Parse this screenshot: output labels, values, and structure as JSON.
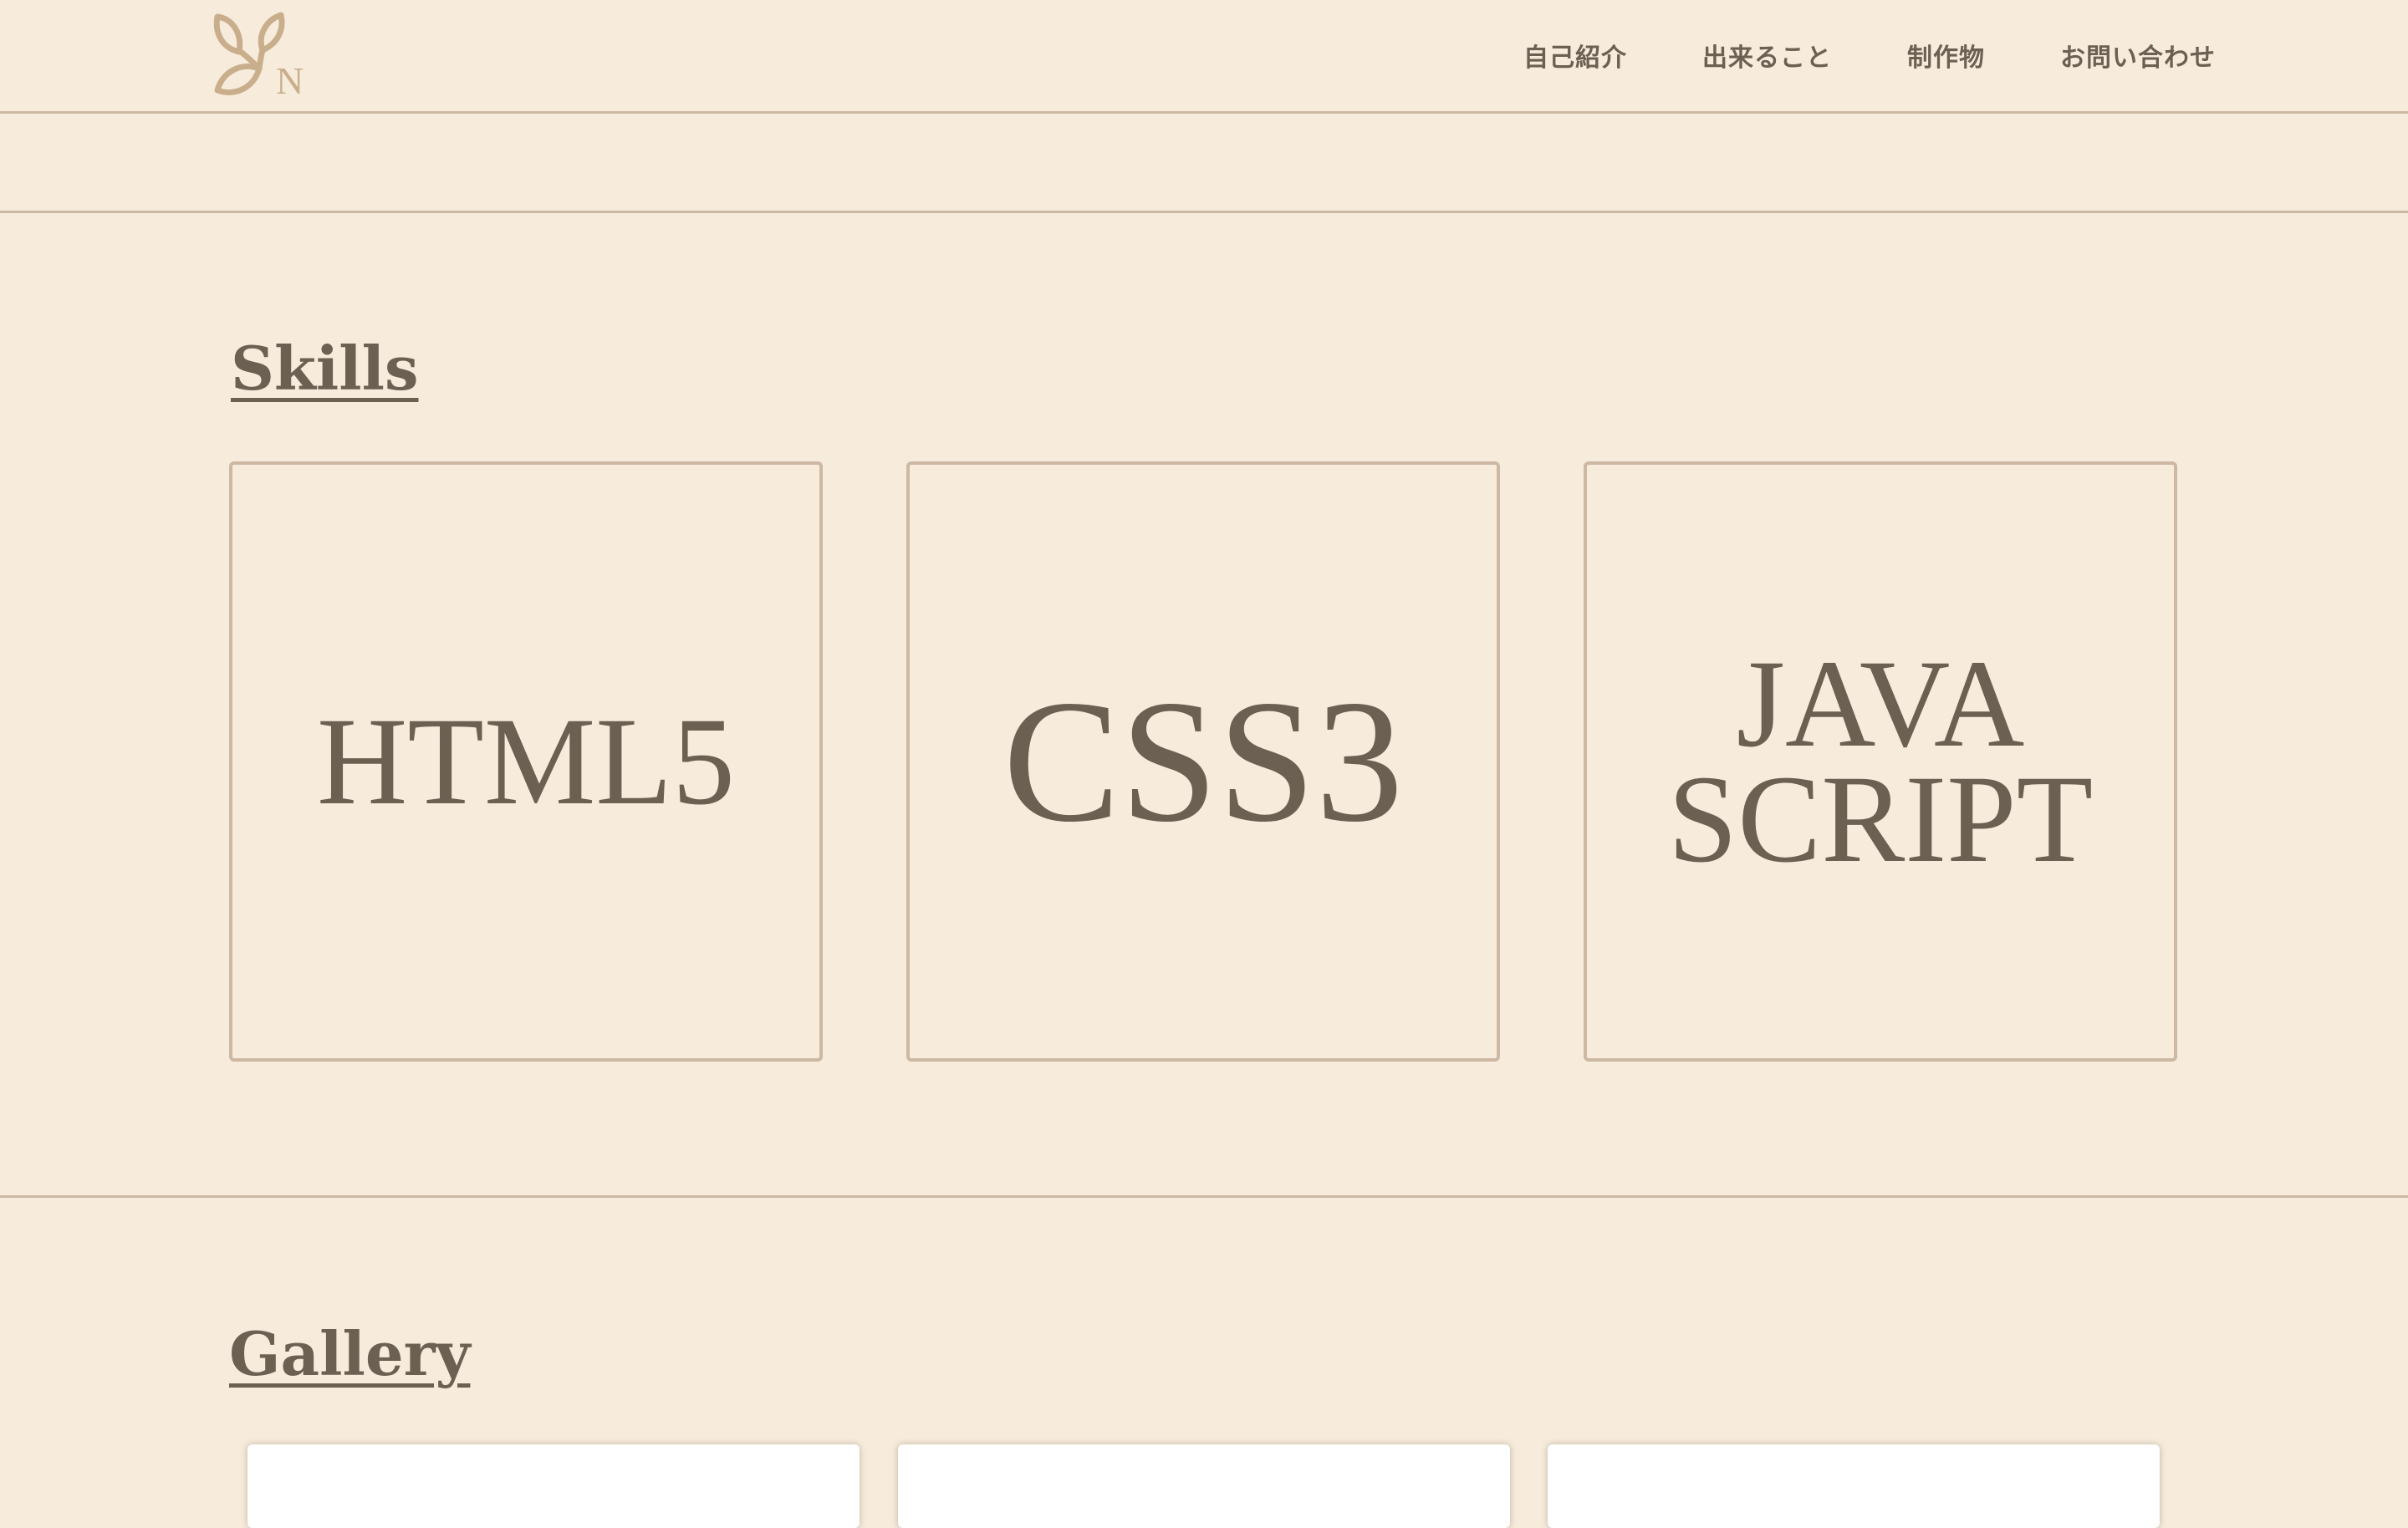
{
  "header": {
    "logo_icon": "leaf-monogram-logo",
    "logo_letter": "N",
    "nav": [
      {
        "label": "自己紹介"
      },
      {
        "label": "出来ること"
      },
      {
        "label": "制作物"
      },
      {
        "label": "お問い合わせ"
      }
    ]
  },
  "skills": {
    "title": "Skills",
    "cards": [
      {
        "lines": [
          "HTML5"
        ]
      },
      {
        "lines": [
          "CSS3"
        ]
      },
      {
        "lines": [
          "JAVA",
          "SCRIPT"
        ]
      }
    ]
  },
  "gallery": {
    "title": "Gallery"
  },
  "colors": {
    "background": "#f7ecdc",
    "text": "#6b6052",
    "border": "#cdb8a3",
    "logo": "#c9ae8c"
  }
}
